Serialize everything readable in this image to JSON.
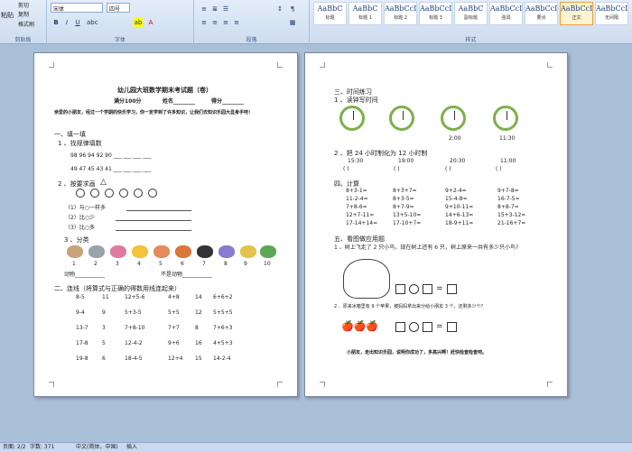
{
  "ribbon": {
    "clipboard": {
      "cut": "剪切",
      "copy": "复制",
      "paste": "粘贴",
      "format_painter": "格式刷",
      "label": "剪贴板"
    },
    "font": {
      "name": "宋体",
      "size": "四号",
      "label": "字体"
    },
    "paragraph": {
      "label": "段落"
    },
    "styles": {
      "label": "样式",
      "items": [
        {
          "sample": "AaBbC",
          "name": "标题"
        },
        {
          "sample": "AaBbC",
          "name": "标题 1"
        },
        {
          "sample": "AaBbCcD",
          "name": "标题 2"
        },
        {
          "sample": "AaBbCcDd",
          "name": "标题 3"
        },
        {
          "sample": "AaBbC",
          "name": "副标题"
        },
        {
          "sample": "AaBbCcDc",
          "name": "强调"
        },
        {
          "sample": "AaBbCcDd",
          "name": "要点"
        },
        {
          "sample": "AaBbCcDc",
          "name": "正文"
        },
        {
          "sample": "AaBbCcDc",
          "name": "无间隔"
        },
        {
          "sample": "AaBbCcDc",
          "name": "不明显"
        }
      ]
    }
  },
  "status": {
    "page": "页面: 2/2",
    "words": "字数: 371",
    "language": "中文(简体，中国)",
    "mode": "插入"
  },
  "page1": {
    "title": "幼儿园大班数学期末考试题（卷）",
    "score_line": "满分100分",
    "name_label": "姓名________",
    "score_label": "得分________",
    "intro": "亲爱的小朋友，经过一个学期的快乐学习，你一定学到了许多知识，让我们去知识乐园大显身手吧！",
    "s1": "一、填一填",
    "s1_1": "1 、找规律填数",
    "row1": "98   96   94   92   90 ___  ___  ___  ___",
    "row2": "49   47   45   43   41 ___  ___  ___  ___",
    "s1_2": "2 、按要求画",
    "q1": "（1）与○一样多",
    "q2": "（2）比○少",
    "q3": "（3）比○多",
    "s1_3": "3 、分类",
    "nums": [
      "1",
      "2",
      "3",
      "4",
      "5",
      "6",
      "7",
      "8",
      "9",
      "10"
    ],
    "animals": "动物___________",
    "not_animals": "不是动物___________",
    "s2": "二、连线（将算式与正确的得数用线连起来）",
    "table": [
      [
        "8-5",
        "11",
        "12+5-6",
        "4+8",
        "14",
        "6+6+2"
      ],
      [
        "9-4",
        "9",
        "5+3-5",
        "5+5",
        "12",
        "5+5+5"
      ],
      [
        "13-7",
        "3",
        "7+8-10",
        "7+7",
        "8",
        "7+6+3"
      ],
      [
        "17-8",
        "5",
        "12-4-2",
        "9+6",
        "16",
        "4+5+3"
      ],
      [
        "19-8",
        "6",
        "18-4-5",
        "12+4",
        "15",
        "14-2-4"
      ]
    ]
  },
  "page2": {
    "s3": "三、时间练习",
    "s3_1": "1 、读钟写时间",
    "clock_times": [
      "2:00",
      "11:30"
    ],
    "s3_2": "2 、把 24 小时制化为 12 小时制",
    "t24": [
      "15:30",
      "19:00",
      "20:30",
      "11:00"
    ],
    "paren": "(        )",
    "s4": "四、计算",
    "calc": [
      [
        "8+3-1=",
        "8+3+7=",
        "9+2-4=",
        "9+7-8="
      ],
      [
        "11-2-4=",
        "8+3-5=",
        "15-4-8=",
        "16-7-5="
      ],
      [
        "7+8-6=",
        "8+7-9=",
        "9+10-11=",
        "8+8-7="
      ],
      [
        "12+7-11=",
        "13+5-10=",
        "14+6-13=",
        "15+3-12="
      ],
      [
        "17-14+14=",
        "17-10+7=",
        "18-9+11=",
        "21-16+7="
      ]
    ],
    "s5": "五、看图做应用题",
    "q5_1": "1 、树上飞走了 2 只小鸟，现在树上还有 6 只，树上原来一共有多少只小鸟?",
    "q5_2": "2 、原来冰箱里有 9 个苹果，被妈妈拿出来分给小朋友 3 个，还剩多少个？",
    "ending": "小朋友，走出知识乐园，说明你成功了，多高兴啊！赶快检查检查吧。"
  },
  "colors": {
    "ribbon": "#dbe6f5",
    "workspace": "#aabfd8",
    "clock": "#7fb04a"
  }
}
